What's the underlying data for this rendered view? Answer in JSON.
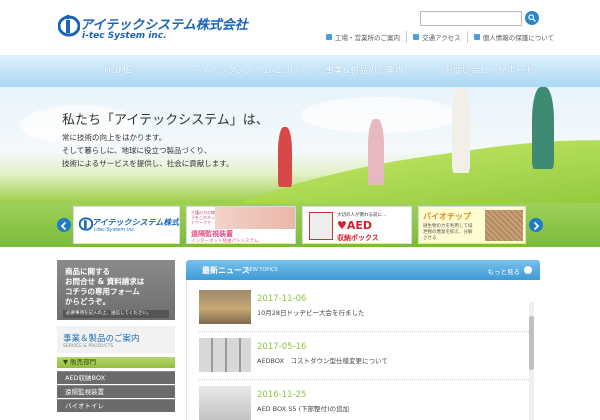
{
  "header": {
    "logo_jp": "アイテックシステム株式会社",
    "logo_en": "i-tec System inc.",
    "search_placeholder": "",
    "util_nav": [
      {
        "label": "工場・営業所のご案内",
        "icon": "building-icon"
      },
      {
        "label": "交通アクセス",
        "icon": "map-icon"
      },
      {
        "label": "個人情報の保護について",
        "icon": "lock-icon"
      }
    ]
  },
  "nav": {
    "items": [
      "HOME",
      "アイテックシステムについて",
      "事業&製品のご案内",
      "お問い合せ・サポート"
    ]
  },
  "hero": {
    "title": "私たち「アイテックシステム」は、",
    "lines": [
      "常に技術の向上をはかります。",
      "そして暮らしに、地球に役立つ製品づくり、",
      "技術によるサービスを提供し、社会に貢献します。"
    ]
  },
  "banners": {
    "b1": {
      "jp": "アイテックシステム株式会社",
      "en": "i-tec System inc."
    },
    "b2": {
      "sub": "介護の方の様子をこのネットワークで",
      "title": "遠隔監視装置",
      "caption": "インターネット経由パトシステム"
    },
    "b3": {
      "lead": "大切の人が倒れる前に…",
      "title": "♥AED",
      "sub": "収納ボックス"
    },
    "b4": {
      "title": "バイオチップ",
      "text": "微生物の力を利用して排泄物の悪臭を抑え、分解させる"
    }
  },
  "sidebar": {
    "contact_banner": {
      "lines": [
        "商品に関する",
        "お問合せ & 資料請求は",
        "コチラの専用フォーム",
        "からどうぞ。"
      ],
      "note": "必要事項を記入の上、送信してください。"
    },
    "heading_jp": "事業＆製品のご案内",
    "heading_en": "SERVICE & PRODUCTS",
    "category": "▼ 販売部門",
    "items": [
      "AED収納BOX",
      "遠隔監視装置",
      "バイオトイレ"
    ]
  },
  "news": {
    "title": "最新ニュース",
    "subtitle": "NEW TOPICS",
    "more": "もっと見る",
    "items": [
      {
        "date": "2017-11-06",
        "text": "10月28日ドッヂビー大会を行ました"
      },
      {
        "date": "2017-05-16",
        "text": "AEDBOX　コストダウン型仕様変更について"
      },
      {
        "date": "2016-11-25",
        "text": "AED BOX S5 (下部整付)の追加"
      }
    ]
  },
  "colors": {
    "brand_blue": "#1a63b8",
    "nav_light": "#dff0fb",
    "green": "#8cc63f",
    "news_blue": "#3e9ad6"
  }
}
